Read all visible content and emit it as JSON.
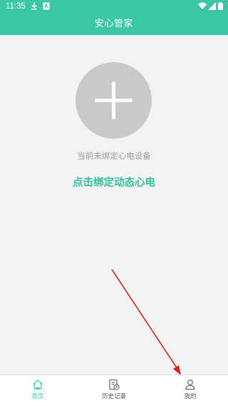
{
  "status_bar": {
    "time": "11:35",
    "icons": [
      "download-icon",
      "notification-icon",
      "wifi-icon",
      "signal-icon",
      "battery-icon"
    ]
  },
  "header": {
    "title": "安心管家"
  },
  "main": {
    "add_button_icon": "plus-icon",
    "no_device_text": "当前未绑定心电设备",
    "bind_link_text": "点击绑定动态心电"
  },
  "bottom_nav": {
    "items": [
      {
        "label": "首页",
        "icon": "home-icon",
        "active": true
      },
      {
        "label": "历史记录",
        "icon": "history-record-icon",
        "active": false
      },
      {
        "label": "我的",
        "icon": "profile-icon",
        "active": false
      }
    ]
  },
  "colors": {
    "primary": "#3bc6a6",
    "background": "#f3f3f4",
    "add_button_bg": "#cbc9c8",
    "link_text": "#2fbf9f",
    "annotation_arrow": "#d62020"
  }
}
